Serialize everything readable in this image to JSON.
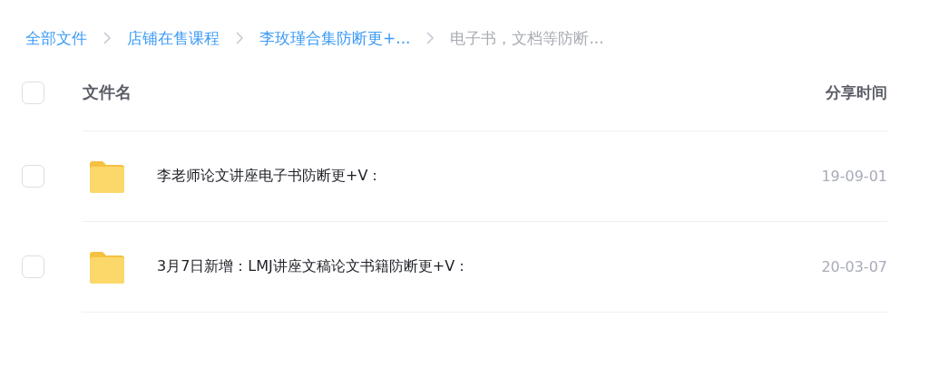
{
  "breadcrumb": [
    {
      "label": "全部文件",
      "current": false
    },
    {
      "label": "店铺在售课程",
      "current": false
    },
    {
      "label": "李玫瑾合集防断更+...",
      "current": false
    },
    {
      "label": "电子书，文档等防断...",
      "current": true
    }
  ],
  "header": {
    "checked": false,
    "name_column": "文件名",
    "time_column": "分享时间"
  },
  "files": [
    {
      "checked": false,
      "name": "李老师论文讲座电子书防断更+V：",
      "time": "19-09-01"
    },
    {
      "checked": false,
      "name": "3月7日新增：LMJ讲座文稿论文书籍防断更+V：",
      "time": "20-03-07"
    }
  ]
}
